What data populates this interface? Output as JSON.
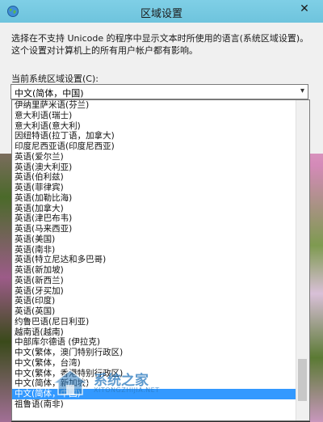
{
  "window": {
    "title": "区域设置",
    "close_glyph": "✕"
  },
  "description": "选择在不支持 Unicode 的程序中显示文本时所使用的语言(系统区域设置)。这个设置对计算机上的所有用户帐户都有影响。",
  "locale": {
    "label": "当前系统区域设置(C):",
    "selected": "中文(简体，中国)",
    "options": [
      "伊纳里萨米语(芬兰)",
      "意大利语(瑞士)",
      "意大利语(意大利)",
      "因纽特语(拉丁语，加拿大)",
      "印度尼西亚语(印度尼西亚)",
      "英语(爱尔兰)",
      "英语(澳大利亚)",
      "英语(伯利兹)",
      "英语(菲律宾)",
      "英语(加勒比海)",
      "英语(加拿大)",
      "英语(津巴布韦)",
      "英语(马来西亚)",
      "英语(美国)",
      "英语(南非)",
      "英语(特立尼达和多巴哥)",
      "英语(新加坡)",
      "英语(新西兰)",
      "英语(牙买加)",
      "英语(印度)",
      "英语(英国)",
      "约鲁巴语(尼日利亚)",
      "越南语(越南)",
      "中部库尔德语 (伊拉克)",
      "中文(繁体，澳门特别行政区)",
      "中文(繁体，台湾)",
      "中文(繁体，香港特别行政区)",
      "中文(简体，新加坡)",
      "中文(简体，中国)",
      "祖鲁语(南非)"
    ],
    "selected_index": 28
  },
  "watermark": {
    "text": "系统之家",
    "sub": "XITONGZHIJIA.NET"
  },
  "colors": {
    "titlebar": "#7fcfe6",
    "selection": "#3399ff"
  }
}
